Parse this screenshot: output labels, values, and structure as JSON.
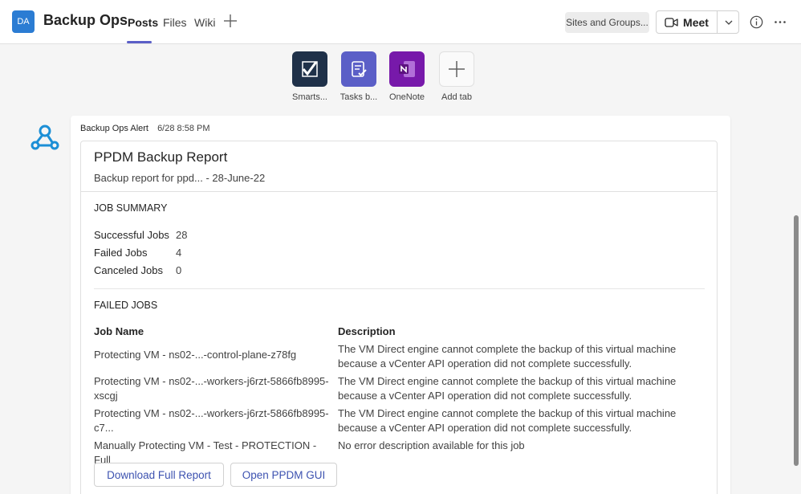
{
  "header": {
    "avatar_initials": "DA",
    "team_name": "Backup Ops",
    "tabs": [
      {
        "label": "Posts",
        "active": true
      },
      {
        "label": "Files",
        "active": false
      },
      {
        "label": "Wiki",
        "active": false
      }
    ],
    "add_tab_icon": "plus-icon",
    "sites_label": "Sites and Groups...",
    "meet_label": "Meet",
    "accent_color": "#5b5fc7"
  },
  "apps": [
    {
      "label": "Smarts...",
      "color": "#1f3149",
      "icon": "smartsheet-icon"
    },
    {
      "label": "Tasks b...",
      "color": "#5b5fc7",
      "icon": "tasks-icon"
    },
    {
      "label": "OneNote",
      "color": "#7719aa",
      "icon": "onenote-icon"
    },
    {
      "label": "Add tab",
      "color": "#f5f5f5",
      "icon": "plus-icon"
    }
  ],
  "message": {
    "sender": "Backup Ops Alert",
    "timestamp": "6/28 8:58 PM",
    "card": {
      "title": "PPDM Backup Report",
      "subtitle": "Backup report for ppd... - 28-June-22",
      "job_summary_heading": "JOB SUMMARY",
      "summary": [
        {
          "label": "Successful Jobs",
          "value": "28"
        },
        {
          "label": "Failed Jobs",
          "value": "4"
        },
        {
          "label": "Canceled Jobs",
          "value": "0"
        }
      ],
      "failed_jobs_heading": "FAILED JOBS",
      "columns": {
        "job": "Job Name",
        "description": "Description"
      },
      "rows": [
        {
          "job": "Protecting VM - ns02-...-control-plane-z78fg",
          "description": "The VM Direct engine cannot complete the backup of this virtual machine because a vCenter API operation did not complete successfully."
        },
        {
          "job": "Protecting VM - ns02-...-workers-j6rzt-5866fb8995-xscgj",
          "description": "The VM Direct engine cannot complete the backup of this virtual machine because a vCenter API operation did not complete successfully."
        },
        {
          "job": "Protecting VM - ns02-...-workers-j6rzt-5866fb8995-c7...",
          "description": "The VM Direct engine cannot complete the backup of this virtual machine because a vCenter API operation did not complete successfully."
        },
        {
          "job": "Manually Protecting VM - Test - PROTECTION - Full",
          "description": "No error description available for this job"
        }
      ],
      "actions": [
        {
          "label": "Download Full Report"
        },
        {
          "label": "Open PPDM GUI"
        }
      ]
    }
  }
}
